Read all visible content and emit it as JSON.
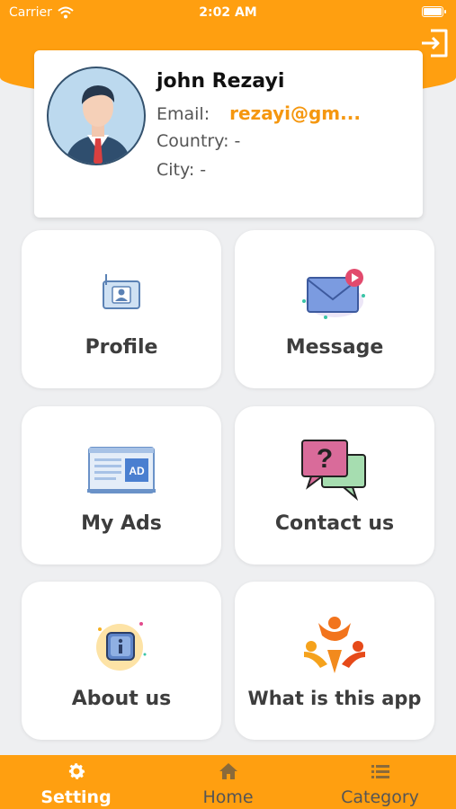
{
  "status_bar": {
    "carrier": "Carrier",
    "time": "2:02 AM"
  },
  "header": {
    "logout_icon": "logout-icon"
  },
  "profile": {
    "name": "john Rezayi",
    "email_label": "Email:",
    "email_value": "rezayi@gm...",
    "country_label": "Country: -",
    "city_label": "City: -"
  },
  "menu": {
    "items": [
      {
        "label": "Profile",
        "icon": "id-badge-icon"
      },
      {
        "label": "Message",
        "icon": "envelope-icon"
      },
      {
        "label": "My Ads",
        "icon": "ad-icon"
      },
      {
        "label": "Contact us",
        "icon": "question-chat-icon"
      },
      {
        "label": "About us",
        "icon": "info-icon"
      },
      {
        "label": "What is this app",
        "icon": "people-icon"
      }
    ]
  },
  "tabbar": {
    "tabs": [
      {
        "label": "Setting",
        "icon": "gear-icon",
        "active": true
      },
      {
        "label": "Home",
        "icon": "home-icon",
        "active": false
      },
      {
        "label": "Category",
        "icon": "list-icon",
        "active": false
      }
    ]
  },
  "colors": {
    "accent": "#ff9f10",
    "background": "#eeeff1",
    "email": "#f5970f"
  }
}
